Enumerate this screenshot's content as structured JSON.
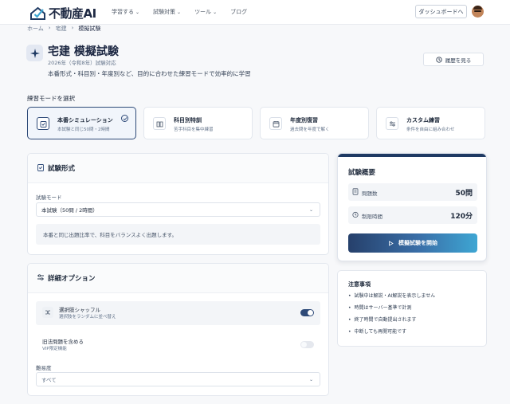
{
  "header": {
    "logo_text": "不動産AI",
    "nav": [
      {
        "label": "学習する",
        "has_dropdown": true
      },
      {
        "label": "試験対策",
        "has_dropdown": true
      },
      {
        "label": "ツール",
        "has_dropdown": true
      },
      {
        "label": "ブログ",
        "has_dropdown": false
      }
    ],
    "dashboard_label": "ダッシュボードへ"
  },
  "breadcrumb": [
    "ホーム",
    "宅建",
    "模擬試験"
  ],
  "page": {
    "title": "宅建 模擬試験",
    "subtitle": "2026年（令和8年）試験対応",
    "description": "本番形式・科目別・年度別など、目的に合わせた練習モードで効率的に学習",
    "history_label": "履歴を見る"
  },
  "mode_section": {
    "label": "練習モードを選択",
    "modes": [
      {
        "title": "本番シミュレーション",
        "sub": "本試験と同じ50問・2時間",
        "icon": "clipboard-check-icon",
        "active": true
      },
      {
        "title": "科目別特訓",
        "sub": "苦手科目を集中練習",
        "icon": "book-icon",
        "active": false
      },
      {
        "title": "年度別復習",
        "sub": "過去問を年度で解く",
        "icon": "calendar-icon",
        "active": false
      },
      {
        "title": "カスタム練習",
        "sub": "条件を自由に組み合わせ",
        "icon": "sliders-icon",
        "active": false
      }
    ]
  },
  "format_panel": {
    "title": "試験形式",
    "mode_label": "試験モード",
    "mode_value": "本試験（50問 / 2時間）",
    "info": "本番と同じ出題比率で、科目をバランスよく出題します。"
  },
  "options_panel": {
    "title": "詳細オプション",
    "options": [
      {
        "title": "選択肢シャッフル",
        "sub": "選択肢をランダムに並べ替え",
        "enabled": true
      },
      {
        "title": "旧法問題を含める",
        "sub": "VIP限定機能",
        "enabled": false
      }
    ],
    "difficulty_label": "難易度",
    "difficulty_value": "すべて"
  },
  "summary": {
    "title": "試験概要",
    "rows": [
      {
        "label": "問題数",
        "value": "50問",
        "icon": "document-icon"
      },
      {
        "label": "制限時間",
        "value": "120分",
        "icon": "clock-icon"
      }
    ],
    "start_label": "模擬試験を開始",
    "accent_color": "#1f3a63"
  },
  "notes": {
    "title": "注意事項",
    "items": [
      "試験中は解説・AI解説を表示しません",
      "時間はサーバー基準で計測",
      "終了時間で自動提出されます",
      "中断しても再開可能です"
    ]
  }
}
